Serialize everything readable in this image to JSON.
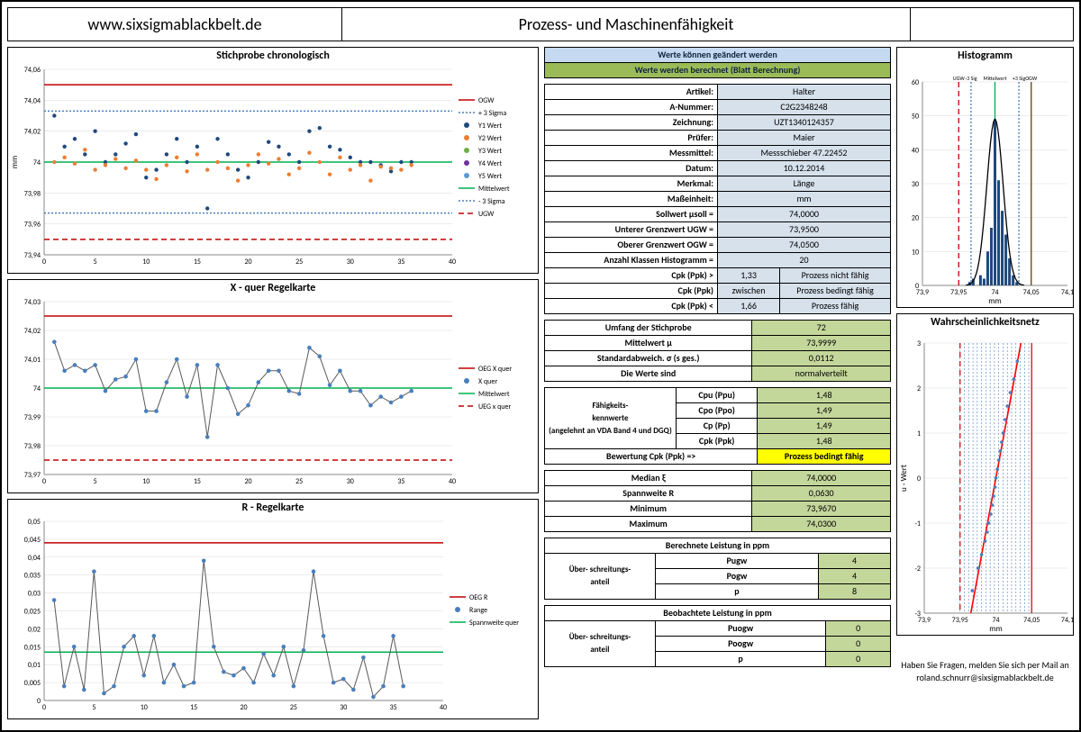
{
  "header": {
    "url": "www.sixsigmablackbelt.de",
    "title": "Prozess- und Maschinenfähigkeit"
  },
  "legend_box": {
    "editable": "Werte können geändert werden",
    "computed": "Werte werden berechnet (Blatt Berechnung)"
  },
  "meta": {
    "Artikel": "Halter",
    "A-Nummer": "C2G2348248",
    "Zeichnung": "UZT1340124357",
    "Prüfer": "Maier",
    "Messmittel": "Messschieber 47.22452",
    "Datum": "10.12.2014",
    "Merkmal": "Länge",
    "Maßeinheit": "mm",
    "Sollwert": "74,0000",
    "UGW": "73,9500",
    "OGW": "74,0500",
    "Klassen": "20",
    "cpk_gt": "1,33",
    "cpk_gt_txt": "Prozess nicht fähig",
    "cpk_bw": "zwischen",
    "cpk_bw_txt": "Prozess bedingt fähig",
    "cpk_lt": "1,66",
    "cpk_lt_txt": "Prozess fähig"
  },
  "labels": {
    "Artikel": "Artikel:",
    "A-Nummer": "A-Nummer:",
    "Zeichnung": "Zeichnung:",
    "Prüfer": "Prüfer:",
    "Messmittel": "Messmittel:",
    "Datum": "Datum:",
    "Merkmal": "Merkmal:",
    "Maßeinheit": "Maßeinheit:",
    "Sollwert": "Sollwert μsoll =",
    "UGW": "Unterer Grenzwert UGW =",
    "OGW": "Oberer Grenzwert OGW =",
    "Klassen": "Anzahl Klassen Histogramm =",
    "cpk_gt": "Cpk (Ppk) >",
    "cpk_bw": "Cpk (Ppk)",
    "cpk_lt": "Cpk (Ppk) <"
  },
  "stats": {
    "n_lbl": "Umfang der Stichprobe",
    "n": "72",
    "mu_lbl": "Mittelwert μ",
    "mu": "73,9999",
    "sd_lbl": "Standardabweich. σ (s ges.)",
    "sd": "0,0112",
    "dist_lbl": "Die Werte sind",
    "dist": "normalverteilt"
  },
  "cap": {
    "hdr": "Fähigkeits-\nkennwerte\n(angelehnt an VDA Band 4 und DGQ)",
    "rows": [
      [
        "Cpu (Ppu)",
        "1,48"
      ],
      [
        "Cpo (Ppo)",
        "1,49"
      ],
      [
        "Cp (Pp)",
        "1,49"
      ],
      [
        "Cpk (Ppk)",
        "1,48"
      ]
    ],
    "eval_lbl": "Bewertung Cpk (Ppk) =>",
    "eval": "Prozess bedingt fähig"
  },
  "loc": {
    "rows": [
      [
        "Median ξ",
        "74,0000"
      ],
      [
        "Spannweite R",
        "0,0630"
      ],
      [
        "Minimum",
        "73,9670"
      ],
      [
        "Maximum",
        "74,0300"
      ]
    ]
  },
  "ppm_calc": {
    "title": "Berechnete Leistung in ppm",
    "side": "Über- schreitungs-\nanteil",
    "rows": [
      [
        "Pugw",
        "4"
      ],
      [
        "Pogw",
        "4"
      ],
      [
        "p",
        "8"
      ]
    ]
  },
  "ppm_obs": {
    "title": "Beobachtete Leistung in ppm",
    "side": "Über- schreitungs-\nanteil",
    "rows": [
      [
        "Puogw",
        "0"
      ],
      [
        "Poogw",
        "0"
      ],
      [
        "p",
        "0"
      ]
    ]
  },
  "contact": {
    "l1": "Haben Sie Fragen, melden Sie sich per Mail an",
    "l2": "roland.schnurr@sixsigmablackbelt.de"
  },
  "chart_data": [
    {
      "id": "stichprobe",
      "type": "scatter",
      "title": "Stichprobe chronologisch",
      "xlabel": "",
      "ylabel": "mm",
      "xlim": [
        0,
        40
      ],
      "ylim": [
        73.94,
        74.06
      ],
      "yticks": [
        73.94,
        73.96,
        73.98,
        74.0,
        74.02,
        74.04,
        74.06
      ],
      "xticks": [
        0,
        5,
        10,
        15,
        20,
        25,
        30,
        35,
        40
      ],
      "lines": {
        "OGW": 74.05,
        "+3 Sigma": 74.033,
        "Mittelwert": 74.0,
        "-3 Sigma": 73.967,
        "UGW": 73.95
      },
      "series": [
        {
          "name": "Y1 Wert",
          "color": "#1f497d",
          "x": [
            1,
            2,
            3,
            4,
            5,
            6,
            7,
            8,
            9,
            10,
            11,
            12,
            13,
            14,
            15,
            16,
            17,
            18,
            19,
            20,
            21,
            22,
            23,
            24,
            25,
            26,
            27,
            28,
            29,
            30,
            31,
            32,
            33,
            34,
            35,
            36
          ],
          "y": [
            74.03,
            74.01,
            74.015,
            74.005,
            74.02,
            74.0,
            74.005,
            74.012,
            74.018,
            73.99,
            73.995,
            74.005,
            74.015,
            74.0,
            74.01,
            73.97,
            74.015,
            74.005,
            73.995,
            73.99,
            74.0,
            74.013,
            74.01,
            74.005,
            74.0,
            74.02,
            74.022,
            74.01,
            74.008,
            74.003,
            74.0,
            74.0,
            73.998,
            73.994,
            74.0,
            74.0
          ]
        },
        {
          "name": "Y2 Wert",
          "color": "#ed7d31",
          "x": [
            1,
            2,
            3,
            4,
            5,
            6,
            7,
            8,
            9,
            10,
            11,
            12,
            13,
            14,
            15,
            16,
            17,
            18,
            19,
            20,
            21,
            22,
            23,
            24,
            25,
            26,
            27,
            28,
            29,
            30,
            31,
            32,
            33,
            34,
            35,
            36
          ],
          "y": [
            74.0,
            74.003,
            73.999,
            74.008,
            73.995,
            73.998,
            74.002,
            73.996,
            74.001,
            73.995,
            73.989,
            73.998,
            74.003,
            73.994,
            74.005,
            73.995,
            74.0,
            73.996,
            73.988,
            73.998,
            74.005,
            73.999,
            74.002,
            73.992,
            73.996,
            74.006,
            74.0,
            73.992,
            74.003,
            73.995,
            73.998,
            73.988,
            73.997,
            73.996,
            73.995,
            73.998
          ]
        }
      ],
      "legend": [
        "OGW",
        "+ 3 Sigma",
        "Y1 Wert",
        "Y2 Wert",
        "Y3 Wert",
        "Y4 Wert",
        "Y5 Wert",
        "Mittelwert",
        "- 3 Sigma",
        "UGW"
      ]
    },
    {
      "id": "xquer",
      "type": "line",
      "title": "X - quer Regelkarte",
      "xlim": [
        0,
        40
      ],
      "ylim": [
        73.97,
        74.03
      ],
      "xticks": [
        0,
        5,
        10,
        15,
        20,
        25,
        30,
        35,
        40
      ],
      "yticks": [
        73.97,
        73.98,
        73.99,
        74.0,
        74.01,
        74.02,
        74.03
      ],
      "lines": {
        "OEG X quer": 74.025,
        "Mittelwert": 74.0,
        "UEG x quer": 73.975
      },
      "legend": [
        "OEG X quer",
        "X quer",
        "Mittelwert",
        "UEG x quer"
      ],
      "series": [
        {
          "name": "X quer",
          "color": "#4a7ebb",
          "x": [
            1,
            2,
            3,
            4,
            5,
            6,
            7,
            8,
            9,
            10,
            11,
            12,
            13,
            14,
            15,
            16,
            17,
            18,
            19,
            20,
            21,
            22,
            23,
            24,
            25,
            26,
            27,
            28,
            29,
            30,
            31,
            32,
            33,
            34,
            35,
            36
          ],
          "y": [
            74.016,
            74.006,
            74.008,
            74.006,
            74.008,
            73.999,
            74.003,
            74.004,
            74.01,
            73.992,
            73.992,
            74.002,
            74.01,
            73.997,
            74.008,
            73.983,
            74.008,
            74.0,
            73.991,
            73.994,
            74.002,
            74.006,
            74.006,
            73.999,
            73.998,
            74.014,
            74.011,
            74.001,
            74.006,
            73.999,
            73.999,
            73.994,
            73.997,
            73.995,
            73.997,
            73.999
          ]
        }
      ]
    },
    {
      "id": "range",
      "type": "line",
      "title": "R - Regelkarte",
      "xlim": [
        0,
        40
      ],
      "ylim": [
        0,
        0.05
      ],
      "xticks": [
        0,
        5,
        10,
        15,
        20,
        25,
        30,
        35,
        40
      ],
      "yticks": [
        0,
        0.005,
        0.01,
        0.015,
        0.02,
        0.025,
        0.03,
        0.035,
        0.04,
        0.045,
        0.05
      ],
      "lines": {
        "OEG R": 0.044,
        "Spannweite quer": 0.0135
      },
      "legend": [
        "OEG R",
        "Range",
        "Spannweite quer"
      ],
      "series": [
        {
          "name": "Range",
          "color": "#4a7ebb",
          "x": [
            1,
            2,
            3,
            4,
            5,
            6,
            7,
            8,
            9,
            10,
            11,
            12,
            13,
            14,
            15,
            16,
            17,
            18,
            19,
            20,
            21,
            22,
            23,
            24,
            25,
            26,
            27,
            28,
            29,
            30,
            31,
            32,
            33,
            34,
            35,
            36
          ],
          "y": [
            0.028,
            0.004,
            0.015,
            0.003,
            0.036,
            0.002,
            0.004,
            0.015,
            0.018,
            0.007,
            0.018,
            0.005,
            0.01,
            0.004,
            0.005,
            0.039,
            0.015,
            0.008,
            0.007,
            0.009,
            0.005,
            0.013,
            0.007,
            0.015,
            0.004,
            0.014,
            0.036,
            0.018,
            0.005,
            0.006,
            0.003,
            0.012,
            0.001,
            0.004,
            0.018,
            0.004
          ]
        }
      ]
    },
    {
      "id": "hist",
      "type": "bar",
      "title": "Histogramm",
      "xlabel": "mm",
      "xlim": [
        73.9,
        74.1
      ],
      "ylim": [
        0,
        60
      ],
      "xticks": [
        73.9,
        73.95,
        74.0,
        74.05,
        74.1
      ],
      "yticks": [
        0,
        10,
        20,
        30,
        40,
        50,
        60
      ],
      "lines": {
        "UGW": 73.95,
        "-3 Sigma": 73.967,
        "Mittelwert": 74.0,
        "+3 Sigma": 74.033,
        "OGW": 74.05
      },
      "categories": [
        73.965,
        73.97,
        73.975,
        73.98,
        73.985,
        73.99,
        73.995,
        74.0,
        74.005,
        74.01,
        74.015,
        74.02,
        74.025,
        74.03
      ],
      "values": [
        1,
        2,
        0,
        3,
        2,
        10,
        17,
        49,
        31,
        22,
        15,
        8,
        3,
        1
      ]
    },
    {
      "id": "prob",
      "type": "scatter",
      "title": "Wahrscheinlichkeitsnetz",
      "xlabel": "mm",
      "ylabel": "u - Wert",
      "xlim": [
        73.9,
        74.1
      ],
      "ylim": [
        -3,
        3
      ],
      "xticks": [
        73.9,
        73.95,
        74.0,
        74.05,
        74.1
      ],
      "yticks": [
        -3,
        -2,
        -1,
        0,
        1,
        2,
        3
      ],
      "fit": {
        "x1": 73.965,
        "y1": -3,
        "x2": 74.035,
        "y2": 3
      },
      "series": [
        {
          "name": "u",
          "color": "#4a7ebb",
          "x": [
            73.967,
            73.975,
            73.98,
            73.985,
            73.988,
            73.99,
            73.993,
            73.995,
            73.997,
            73.999,
            74.0,
            74.002,
            74.004,
            74.006,
            74.008,
            74.01,
            74.013,
            74.016,
            74.02,
            74.025,
            74.03
          ],
          "y": [
            -2.5,
            -2.0,
            -1.7,
            -1.4,
            -1.2,
            -1.0,
            -0.8,
            -0.6,
            -0.4,
            -0.2,
            0.0,
            0.2,
            0.4,
            0.6,
            0.8,
            1.0,
            1.3,
            1.6,
            1.9,
            2.2,
            2.6
          ]
        }
      ]
    }
  ]
}
